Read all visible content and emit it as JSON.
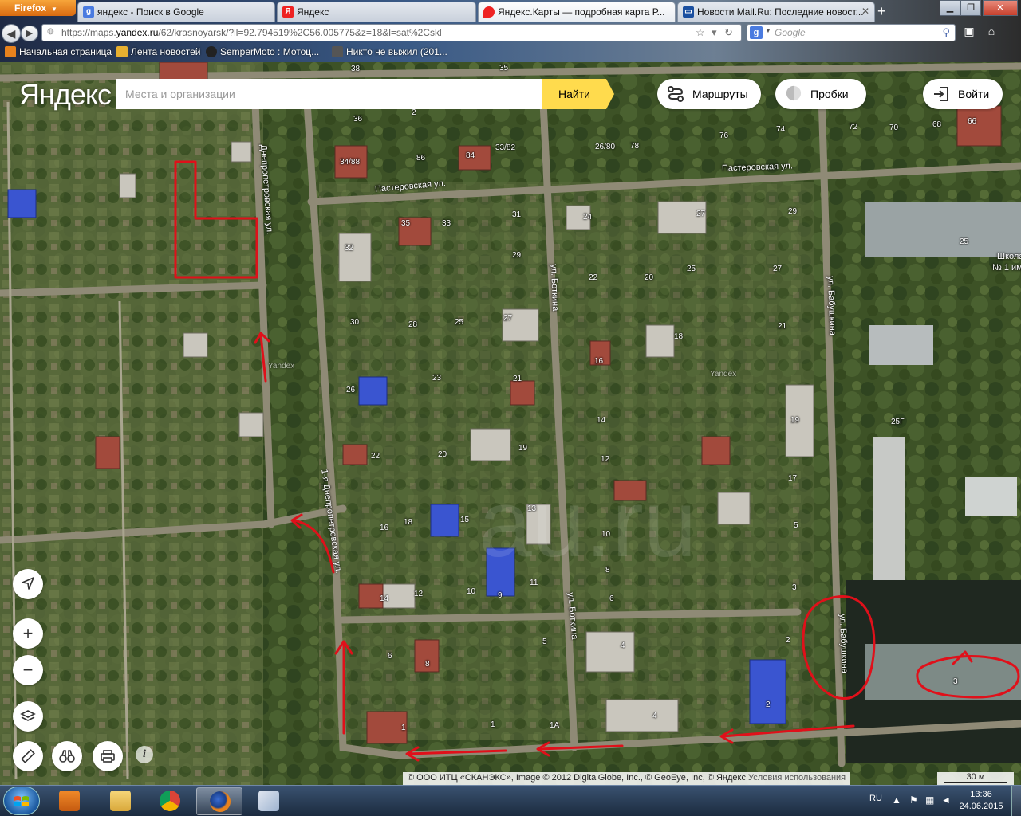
{
  "browser": {
    "app_button": "Firefox",
    "tabs": [
      {
        "title": "яндекс - Поиск в Google",
        "icon": "google-icon",
        "active": false
      },
      {
        "title": "Яндекс",
        "icon": "yandex-icon",
        "active": false
      },
      {
        "title": "Яндекс.Карты — подробная карта Р...",
        "icon": "yandex-maps-icon",
        "active": true
      },
      {
        "title": "Новости Mail.Ru: Последние новост...",
        "icon": "mail-icon",
        "active": false
      }
    ],
    "url_prefix": "https://maps.",
    "url_domain": "yandex.ru",
    "url_rest": "/62/krasnoyarsk/?ll=92.794519%2C56.005775&z=18&l=sat%2Cskl",
    "search_placeholder": "Google",
    "bookmarks": [
      {
        "label": "Начальная страница",
        "icon": "firefox-icon"
      },
      {
        "label": "Лента новостей",
        "icon": "rss-folder-icon"
      },
      {
        "label": "SemperMoto : Мотоц...",
        "icon": "moto-icon"
      },
      {
        "label": "Никто не выжил (201...",
        "icon": "film-icon"
      }
    ]
  },
  "map": {
    "logo": "Яндекс",
    "search_placeholder": "Места и организации",
    "find_button": "Найти",
    "routes_button": "Маршруты",
    "traffic_button": "Пробки",
    "login_button": "Войти",
    "copyright_text": "© ООО ИТЦ «СКАНЭКС», Image © 2012 DigitalGlobe, Inc., © GeoEye, Inc, © Яндекс",
    "terms_link": "Условия использования",
    "scale_label": "30 м",
    "streets": [
      "Пастеровская ул.",
      "Пастеровская ул.",
      "Днепропетровская ул.",
      "1-я Днепропетровская ул.",
      "ул. Боткина",
      "ул. Боткина",
      "ул. Бабушкина",
      "ул. Бабушкина"
    ],
    "place_labels": [
      "Школа",
      "№ 1 им"
    ],
    "house_numbers": [
      "38",
      "35",
      "2",
      "36",
      "34/88",
      "86",
      "84",
      "33/82",
      "26/80",
      "78",
      "76",
      "74",
      "72",
      "70",
      "68",
      "66",
      "35",
      "33",
      "31",
      "24",
      "27",
      "29",
      "25",
      "32",
      "29",
      "22",
      "20",
      "25",
      "27",
      "30",
      "28",
      "25",
      "27",
      "21",
      "18",
      "16",
      "23",
      "21",
      "26",
      "25Г",
      "19",
      "22",
      "20",
      "19",
      "14",
      "12",
      "17",
      "16",
      "18",
      "15",
      "13",
      "10",
      "5",
      "14",
      "12",
      "10",
      "11",
      "9",
      "8",
      "6",
      "3",
      "6",
      "8",
      "5",
      "4",
      "1",
      "1А",
      "2",
      "4",
      "3",
      "1",
      "2"
    ],
    "watermark": "Yandex"
  },
  "taskbar": {
    "apps": [
      "media-player-icon",
      "explorer-icon",
      "chrome-icon",
      "firefox-icon",
      "paint-icon"
    ],
    "active_app": "firefox-icon",
    "lang": "RU",
    "time": "13:36",
    "date": "24.06.2015"
  },
  "colors": {
    "yandex_yellow": "#ffdb4d",
    "annotation_red": "#e0101a",
    "firefox_orange": "#e8821d"
  }
}
